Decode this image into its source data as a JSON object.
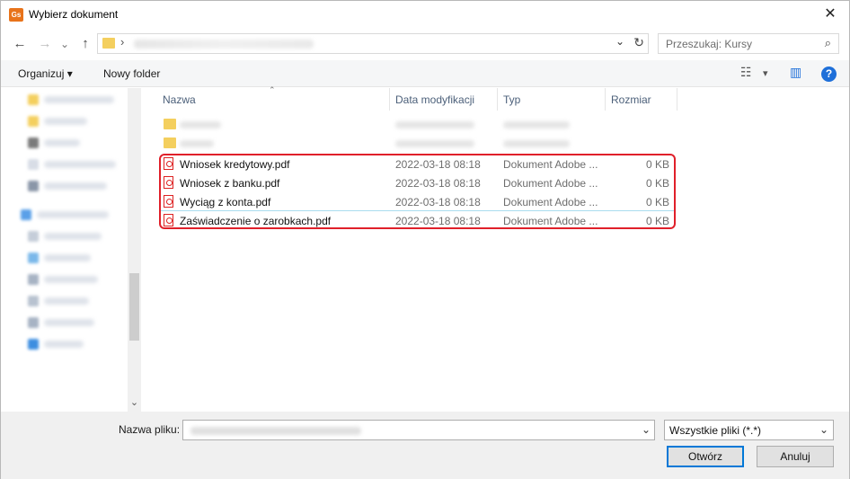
{
  "window": {
    "title": "Wybierz dokument",
    "app_icon_text": "Gs",
    "close_glyph": "✕"
  },
  "nav": {
    "back_glyph": "←",
    "forward_glyph": "→",
    "recent_glyph": "⌄",
    "up_glyph": "↑",
    "address_sep": "›",
    "address_chevron": "⌄",
    "refresh_glyph": "↻",
    "search_placeholder": "Przeszukaj: Kursy",
    "search_glyph": "⌕"
  },
  "toolbar": {
    "organize_label": "Organizuj ▾",
    "new_folder_label": "Nowy folder",
    "view_glyph": "☷",
    "view_chevron": "▾",
    "pane_glyph": "▥",
    "help_glyph": "?"
  },
  "columns": {
    "name": "Nazwa",
    "date": "Data modyfikacji",
    "type": "Typ",
    "size": "Rozmiar",
    "sort_glyph": "⌃"
  },
  "files": [
    {
      "name": "Wniosek kredytowy.pdf",
      "date": "2022-03-18 08:18",
      "type": "Dokument Adobe ...",
      "size": "0 KB"
    },
    {
      "name": "Wniosek z banku.pdf",
      "date": "2022-03-18 08:18",
      "type": "Dokument Adobe ...",
      "size": "0 KB"
    },
    {
      "name": "Wyciąg z konta.pdf",
      "date": "2022-03-18 08:18",
      "type": "Dokument Adobe ...",
      "size": "0 KB"
    },
    {
      "name": "Zaświadczenie o zarobkach.pdf",
      "date": "2022-03-18 08:18",
      "type": "Dokument Adobe ...",
      "size": "0 KB"
    }
  ],
  "colors": {
    "accent": "#0078d7",
    "highlight": "#e0202a",
    "folder": "#f4cf5e"
  },
  "bottom": {
    "filename_label": "Nazwa pliku:",
    "filter_value": "Wszystkie pliki (*.*)",
    "dropdown_glyph": "⌄",
    "open_label": "Otwórz",
    "cancel_label": "Anuluj"
  },
  "sidebar": {
    "scroll_down_glyph": "⌄"
  }
}
